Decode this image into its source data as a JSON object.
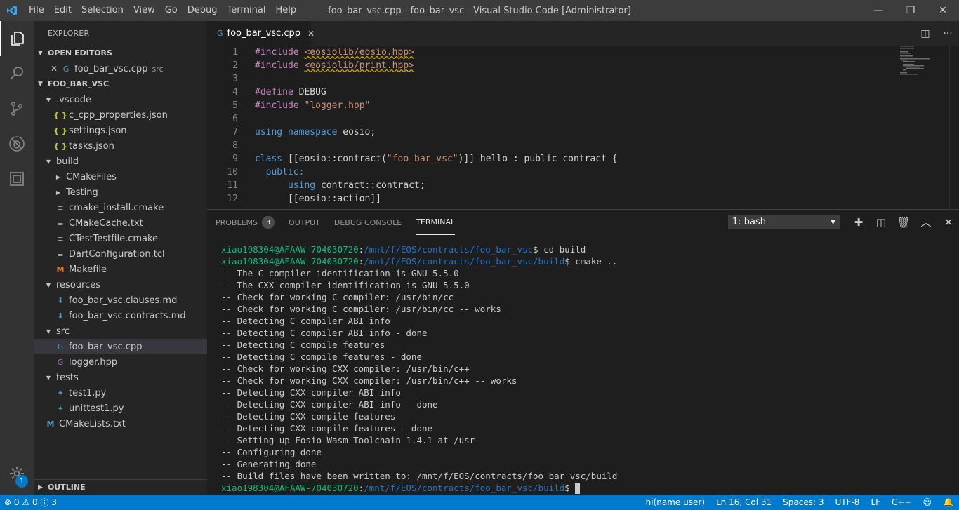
{
  "window": {
    "title": "foo_bar_vsc.cpp - foo_bar_vsc - Visual Studio Code [Administrator]",
    "menu": [
      "File",
      "Edit",
      "Selection",
      "View",
      "Go",
      "Debug",
      "Terminal",
      "Help"
    ],
    "controls": {
      "minimize": "—",
      "restore": "❐",
      "close": "✕"
    }
  },
  "activity": {
    "items": [
      "files-icon",
      "search-icon",
      "source-control-icon",
      "debug-icon",
      "extensions-icon"
    ],
    "manage_badge": "1"
  },
  "sidebar": {
    "title": "EXPLORER",
    "open_editors": {
      "title": "OPEN EDITORS",
      "items": [
        {
          "name": "foo_bar_vsc.cpp",
          "desc": "src"
        }
      ]
    },
    "project": {
      "title": "FOO_BAR_VSC",
      "items": [
        {
          "label": ".vscode",
          "depth": 1,
          "folder": true
        },
        {
          "label": "c_cpp_properties.json",
          "depth": 2,
          "icon": "json"
        },
        {
          "label": "settings.json",
          "depth": 2,
          "icon": "json"
        },
        {
          "label": "tasks.json",
          "depth": 2,
          "icon": "json"
        },
        {
          "label": "build",
          "depth": 1,
          "folder": true
        },
        {
          "label": "CMakeFiles",
          "depth": 2,
          "folder": true,
          "collapsed": true
        },
        {
          "label": "Testing",
          "depth": 2,
          "folder": true,
          "collapsed": true
        },
        {
          "label": "cmake_install.cmake",
          "depth": 2,
          "icon": "cmake"
        },
        {
          "label": "CMakeCache.txt",
          "depth": 2,
          "icon": "cmake"
        },
        {
          "label": "CTestTestfile.cmake",
          "depth": 2,
          "icon": "cmake"
        },
        {
          "label": "DartConfiguration.tcl",
          "depth": 2,
          "icon": "cmake"
        },
        {
          "label": "Makefile",
          "depth": 2,
          "icon": "make"
        },
        {
          "label": "resources",
          "depth": 1,
          "folder": true
        },
        {
          "label": "foo_bar_vsc.clauses.md",
          "depth": 2,
          "icon": "md"
        },
        {
          "label": "foo_bar_vsc.contracts.md",
          "depth": 2,
          "icon": "md"
        },
        {
          "label": "src",
          "depth": 1,
          "folder": true
        },
        {
          "label": "foo_bar_vsc.cpp",
          "depth": 2,
          "icon": "cpp",
          "selected": true
        },
        {
          "label": "logger.hpp",
          "depth": 2,
          "icon": "hpp"
        },
        {
          "label": "tests",
          "depth": 1,
          "folder": true
        },
        {
          "label": "test1.py",
          "depth": 2,
          "icon": "py"
        },
        {
          "label": "unittest1.py",
          "depth": 2,
          "icon": "py"
        },
        {
          "label": "CMakeLists.txt",
          "depth": 1,
          "icon": "cml"
        }
      ]
    },
    "outline_title": "OUTLINE"
  },
  "editor": {
    "tab": {
      "label": "foo_bar_vsc.cpp"
    },
    "line_numbers": [
      "1",
      "2",
      "3",
      "4",
      "5",
      "6",
      "7",
      "8",
      "9",
      "10",
      "11",
      "12"
    ],
    "code": [
      [
        {
          "t": "#include ",
          "c": "pp"
        },
        {
          "t": "<eosiolib/eosio.hpp>",
          "c": "str squig"
        }
      ],
      [
        {
          "t": "#include ",
          "c": "pp"
        },
        {
          "t": "<eosiolib/print.hpp>",
          "c": "str squig"
        }
      ],
      [],
      [
        {
          "t": "#define ",
          "c": "pp"
        },
        {
          "t": "DEBUG",
          "c": ""
        }
      ],
      [
        {
          "t": "#include ",
          "c": "pp"
        },
        {
          "t": "\"logger.hpp\"",
          "c": "str"
        }
      ],
      [],
      [
        {
          "t": "using ",
          "c": "kw"
        },
        {
          "t": "namespace ",
          "c": "kw"
        },
        {
          "t": "eosio;",
          "c": ""
        }
      ],
      [],
      [
        {
          "t": "class ",
          "c": "kw"
        },
        {
          "t": "[[eosio::contract(",
          "c": ""
        },
        {
          "t": "\"foo_bar_vsc\"",
          "c": "str"
        },
        {
          "t": ")]] hello : public contract {",
          "c": ""
        }
      ],
      [
        {
          "t": "  public:",
          "c": "kw"
        }
      ],
      [
        {
          "t": "      ",
          "c": ""
        },
        {
          "t": "using ",
          "c": "kw"
        },
        {
          "t": "contract::contract;",
          "c": ""
        }
      ],
      [
        {
          "t": "      [[eosio::action]]",
          "c": ""
        }
      ]
    ]
  },
  "panel": {
    "tabs": [
      {
        "label": "PROBLEMS",
        "count": "3"
      },
      {
        "label": "OUTPUT"
      },
      {
        "label": "DEBUG CONSOLE"
      },
      {
        "label": "TERMINAL",
        "active": true
      }
    ],
    "terminal_select": "1: bash",
    "terminal": {
      "user": "xiao198304@AFAAW-704030720",
      "lines": [
        {
          "prompt": true,
          "path": "/mnt/f/EOS/contracts/foo_bar_vsc",
          "cmd": "$ cd build"
        },
        {
          "prompt": true,
          "path": "/mnt/f/EOS/contracts/foo_bar_vsc/build",
          "cmd": "$ cmake .."
        },
        {
          "text": "-- The C compiler identification is GNU 5.5.0"
        },
        {
          "text": "-- The CXX compiler identification is GNU 5.5.0"
        },
        {
          "text": "-- Check for working C compiler: /usr/bin/cc"
        },
        {
          "text": "-- Check for working C compiler: /usr/bin/cc -- works"
        },
        {
          "text": "-- Detecting C compiler ABI info"
        },
        {
          "text": "-- Detecting C compiler ABI info - done"
        },
        {
          "text": "-- Detecting C compile features"
        },
        {
          "text": "-- Detecting C compile features - done"
        },
        {
          "text": "-- Check for working CXX compiler: /usr/bin/c++"
        },
        {
          "text": "-- Check for working CXX compiler: /usr/bin/c++ -- works"
        },
        {
          "text": "-- Detecting CXX compiler ABI info"
        },
        {
          "text": "-- Detecting CXX compiler ABI info - done"
        },
        {
          "text": "-- Detecting CXX compile features"
        },
        {
          "text": "-- Detecting CXX compile features - done"
        },
        {
          "text": "-- Setting up Eosio Wasm Toolchain 1.4.1 at /usr"
        },
        {
          "text": "-- Configuring done"
        },
        {
          "text": "-- Generating done"
        },
        {
          "text": "-- Build files have been written to: /mnt/f/EOS/contracts/foo_bar_vsc/build"
        },
        {
          "prompt": true,
          "path": "/mnt/f/EOS/contracts/foo_bar_vsc/build",
          "cmd": "$ ",
          "cursor": true
        }
      ]
    }
  },
  "status": {
    "errors": "0",
    "warnings": "0",
    "infos": "3",
    "right": [
      "hi(name user)",
      "Ln 16, Col 31",
      "Spaces: 3",
      "UTF-8",
      "LF",
      "C++"
    ],
    "colors": {
      "accent": "#007acc"
    }
  }
}
